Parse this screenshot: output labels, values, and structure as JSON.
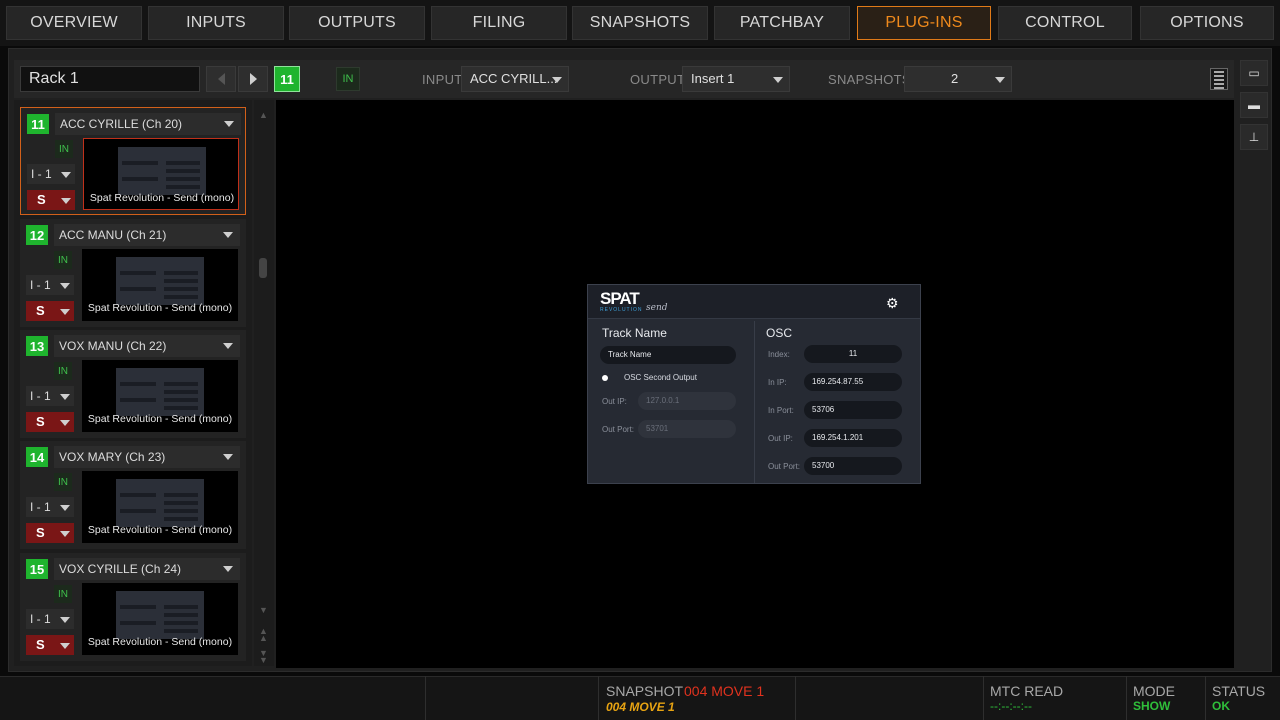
{
  "tabs": [
    {
      "label": "OVERVIEW"
    },
    {
      "label": "INPUTS"
    },
    {
      "label": "OUTPUTS"
    },
    {
      "label": "FILING"
    },
    {
      "label": "SNAPSHOTS"
    },
    {
      "label": "PATCHBAY"
    },
    {
      "label": "PLUG-INS",
      "active": true
    },
    {
      "label": "CONTROL"
    },
    {
      "label": "OPTIONS"
    }
  ],
  "toolbar": {
    "rack_name": "Rack 1",
    "current_slot": "11",
    "in_label": "IN",
    "input_label": "INPUT",
    "input_value": "ACC CYRILL...",
    "output_label": "OUTPUT",
    "output_value": "Insert 1",
    "snapshots_label": "SNAPSHOTS",
    "snapshots_value": "2"
  },
  "slots": [
    {
      "num": "11",
      "name": "ACC CYRILLE (Ch 20)",
      "in": "IN",
      "io": "I - 1",
      "s": "S",
      "plugin": "Spat Revolution - Send (mono)",
      "selected": true
    },
    {
      "num": "12",
      "name": "ACC MANU (Ch 21)",
      "in": "IN",
      "io": "I - 1",
      "s": "S",
      "plugin": "Spat Revolution - Send (mono)"
    },
    {
      "num": "13",
      "name": "VOX MANU (Ch 22)",
      "in": "IN",
      "io": "I - 1",
      "s": "S",
      "plugin": "Spat Revolution - Send (mono)"
    },
    {
      "num": "14",
      "name": "VOX MARY (Ch 23)",
      "in": "IN",
      "io": "I - 1",
      "s": "S",
      "plugin": "Spat Revolution - Send (mono)"
    },
    {
      "num": "15",
      "name": "VOX CYRILLE (Ch 24)",
      "in": "IN",
      "io": "I - 1",
      "s": "S",
      "plugin": "Spat Revolution - Send (mono)"
    }
  ],
  "plugin_window": {
    "logo": "SPAT",
    "logo_sub": "REVOLUTION",
    "variant": "send",
    "track_title": "Track Name",
    "track_name_value": "Track Name",
    "second_output_label": "OSC Second Output",
    "out_ip_label": "Out IP:",
    "out_ip_value": "127.0.0.1",
    "out_port_label": "Out Port:",
    "out_port_value": "53701",
    "osc_title": "OSC",
    "index_label": "Index:",
    "index_value": "11",
    "in_ip_label": "In IP:",
    "in_ip_value": "169.254.87.55",
    "in_port_label": "In Port:",
    "in_port_value": "53706",
    "osc_out_ip_label": "Out IP:",
    "osc_out_ip_value": "169.254.1.201",
    "osc_out_port_label": "Out Port:",
    "osc_out_port_value": "53700"
  },
  "status": {
    "snapshot_label": "SNAPSHOT",
    "snapshot_current": "004 MOVE 1",
    "snapshot_next": "004 MOVE 1",
    "mtc_label": "MTC READ",
    "mtc_value": "--:--:--:--",
    "mode_label": "MODE",
    "mode_value": "SHOW",
    "status_label": "STATUS",
    "status_value": "OK"
  },
  "colors": {
    "accent_orange": "#f08a1c",
    "active_green": "#1fb42e",
    "bypass_red": "#7a1616",
    "snapshot_red": "#e0321e"
  }
}
